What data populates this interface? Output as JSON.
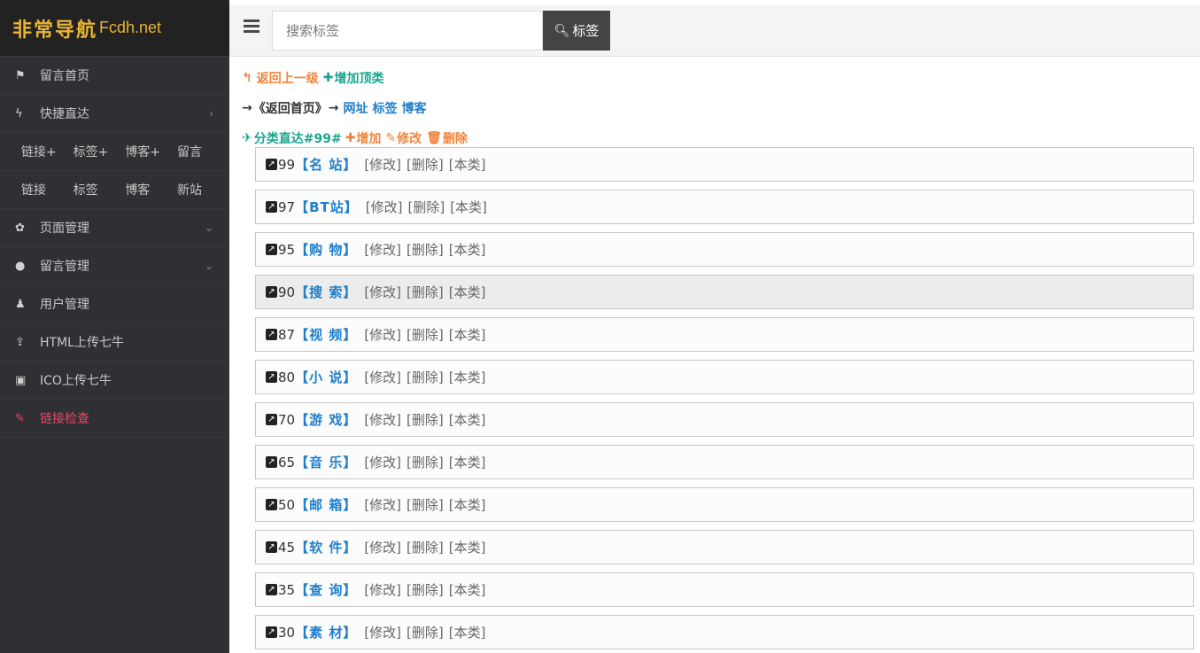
{
  "sidebar": {
    "logo_cn": "非常导航",
    "logo_en": "Fcdh.net",
    "items": [
      {
        "icon": "flag-icon",
        "glyph": "⚑",
        "label": "留言首页",
        "chevron": ""
      },
      {
        "icon": "bolt-icon",
        "glyph": "ϟ",
        "label": "快捷直达",
        "chevron": "›"
      }
    ],
    "quick_row_1": [
      "链接+",
      "标签+",
      "博客+",
      "留言"
    ],
    "quick_row_2": [
      "链接",
      "标签",
      "博客",
      "新站"
    ],
    "items2": [
      {
        "icon": "cubes-icon",
        "glyph": "✿",
        "label": "页面管理",
        "chevron": "⌄"
      },
      {
        "icon": "comment-icon",
        "glyph": "●",
        "label": "留言管理",
        "chevron": "⌄"
      },
      {
        "icon": "user-icon",
        "glyph": "♟",
        "label": "用户管理",
        "chevron": ""
      },
      {
        "icon": "upload-icon",
        "glyph": "⇪",
        "label": "HTML上传七牛",
        "chevron": ""
      },
      {
        "icon": "image-icon",
        "glyph": "▣",
        "label": "ICO上传七牛",
        "chevron": ""
      },
      {
        "icon": "eyedropper-icon",
        "glyph": "✎",
        "label": "链接检查",
        "chevron": ""
      }
    ]
  },
  "topbar": {
    "search_placeholder": "搜索标签",
    "search_button": "标签"
  },
  "content": {
    "back_up": "返回上一级",
    "add_top": "增加顶类",
    "arrow": "→",
    "back_home": "《返回首页》",
    "links": [
      "网址",
      "标签",
      "博客"
    ],
    "category_jump": "分类直达#99#",
    "add": "增加",
    "edit": "修改",
    "delete": "删除"
  },
  "rows": [
    {
      "num": "99",
      "name": "【名 站】"
    },
    {
      "num": "97",
      "name": "【BT站】"
    },
    {
      "num": "95",
      "name": "【购 物】"
    },
    {
      "num": "90",
      "name": "【搜 索】"
    },
    {
      "num": "87",
      "name": "【视 频】"
    },
    {
      "num": "80",
      "name": "【小 说】"
    },
    {
      "num": "70",
      "name": "【游 戏】"
    },
    {
      "num": "65",
      "name": "【音 乐】"
    },
    {
      "num": "50",
      "name": "【邮 箱】"
    },
    {
      "num": "45",
      "name": "【软 件】"
    },
    {
      "num": "35",
      "name": "【查 询】"
    },
    {
      "num": "30",
      "name": "【素 材】"
    }
  ],
  "row_actions": [
    "[修改]",
    "[删除]",
    "[本类]"
  ],
  "colors": {
    "sidebar_bg": "#2f3033",
    "accent_orange": "#f0843d",
    "accent_teal": "#18a58f",
    "link_blue": "#1f7fcc",
    "alert_red": "#e8456b"
  }
}
